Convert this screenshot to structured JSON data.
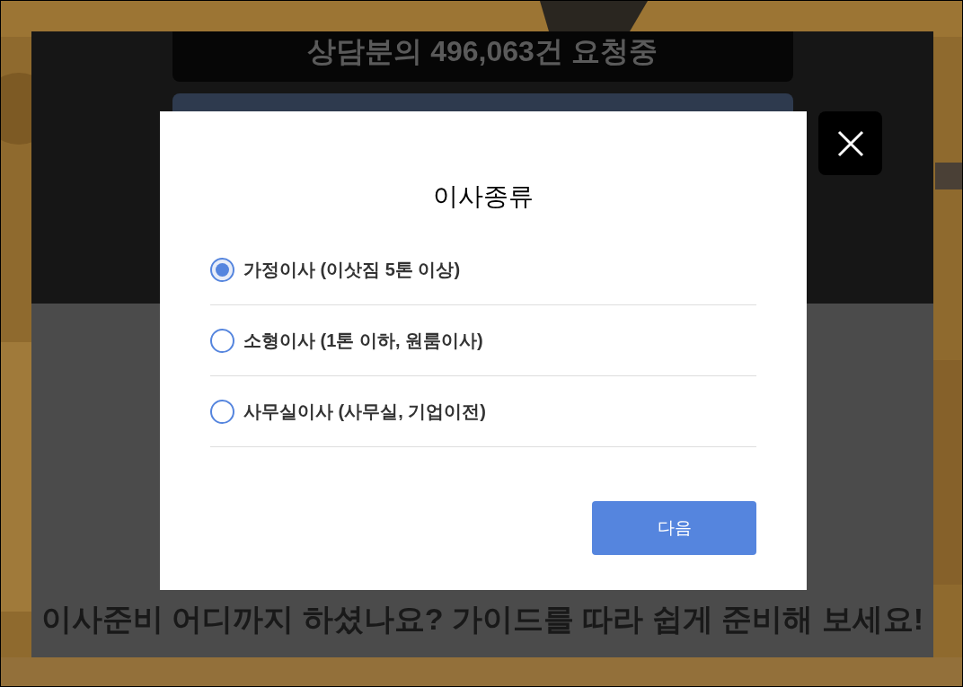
{
  "page": {
    "counter_text": "상담분의 **496,063**건 요청중",
    "guide_text": "이사준비 어디까지 하셨나요? 가이드를 따라 쉽게 준비해 보세요!"
  },
  "dialog": {
    "title": "이사종류",
    "options": [
      {
        "label": "가정이사 (이삿짐 5톤 이상)",
        "selected": true
      },
      {
        "label": "소형이사 (1톤 이하, 원룸이사)",
        "selected": false
      },
      {
        "label": "사무실이사 (사무실, 기업이전)",
        "selected": false
      }
    ],
    "next_button": "다음"
  }
}
